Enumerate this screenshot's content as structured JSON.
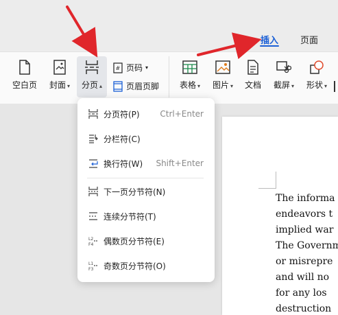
{
  "tabs": {
    "insert": "插入",
    "page": "页面"
  },
  "ribbon": {
    "blank_page": "空白页",
    "cover": "封面",
    "page_break": "分页",
    "page_number": "页码",
    "header_footer": "页眉页脚",
    "table": "表格",
    "picture": "图片",
    "textbox": "文档",
    "screenshot": "截屏",
    "shapes": "形状"
  },
  "menu": {
    "items": [
      {
        "label": "分页符(P)",
        "shortcut": "Ctrl+Enter"
      },
      {
        "label": "分栏符(C)",
        "shortcut": ""
      },
      {
        "label": "换行符(W)",
        "shortcut": "Shift+Enter"
      },
      {
        "label": "下一页分节符(N)",
        "shortcut": ""
      },
      {
        "label": "连续分节符(T)",
        "shortcut": ""
      },
      {
        "label": "偶数页分节符(E)",
        "shortcut": ""
      },
      {
        "label": "奇数页分节符(O)",
        "shortcut": ""
      }
    ]
  },
  "document": {
    "lines": [
      "The informa",
      "endeavors t",
      "implied war",
      "The Governm",
      "or misrepre",
      "and will no",
      "for any los",
      "destruction"
    ]
  },
  "colors": {
    "accent": "#1a5fd6",
    "arrow": "#e0262b"
  }
}
